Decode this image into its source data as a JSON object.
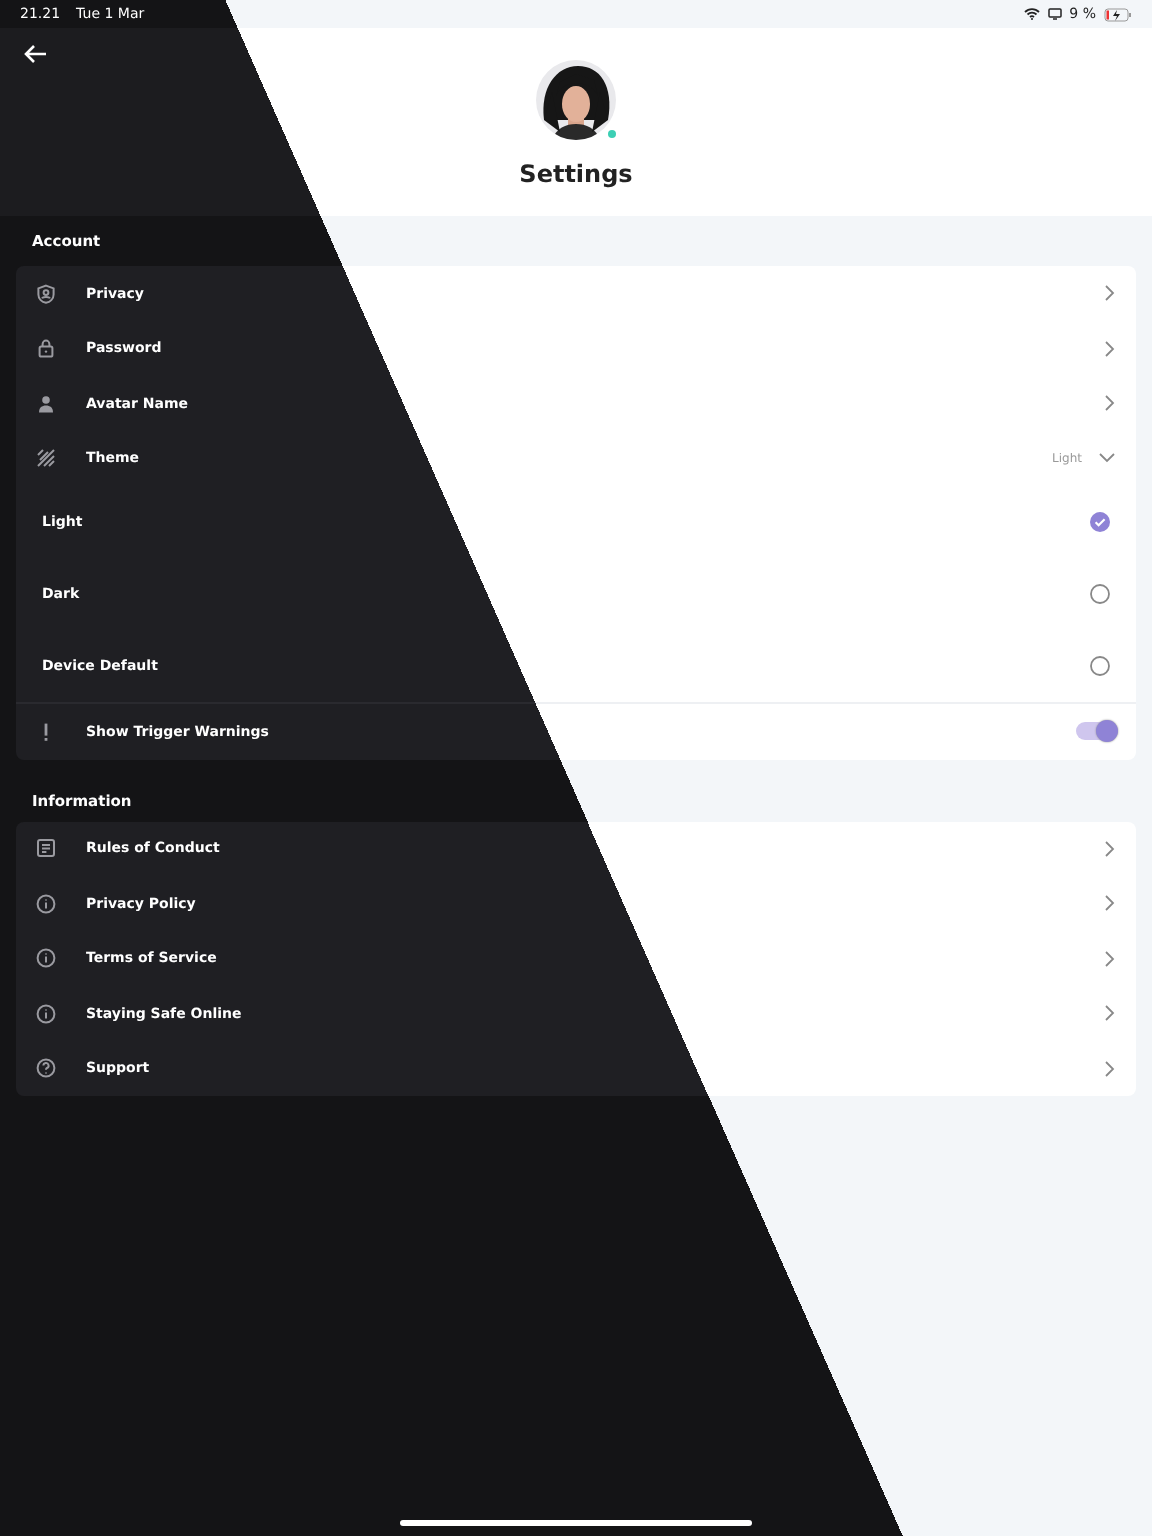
{
  "status_bar": {
    "time": "21.21",
    "date": "Tue 1 Mar",
    "battery": "9 %"
  },
  "header": {
    "title": "Settings",
    "avatar": {
      "kind": "picture",
      "online": true
    }
  },
  "sections": [
    {
      "title": "Account",
      "items": [
        {
          "kind": "link",
          "label": "Privacy"
        },
        {
          "kind": "link",
          "label": "Password"
        },
        {
          "kind": "link",
          "label": "Avatar Name"
        },
        {
          "kind": "select",
          "label": "Theme",
          "value": "Light",
          "expanded": true,
          "options": [
            {
              "label": "Light",
              "selected": true
            },
            {
              "label": "Dark",
              "selected": false
            },
            {
              "label": "Device Default",
              "selected": false
            }
          ]
        },
        {
          "kind": "toggle",
          "label": "Show Trigger Warnings",
          "on": true
        }
      ]
    },
    {
      "title": "Information",
      "items": [
        {
          "kind": "link",
          "label": "Rules of Conduct"
        },
        {
          "kind": "link",
          "label": "Privacy Policy"
        },
        {
          "kind": "link",
          "label": "Terms of Service"
        },
        {
          "kind": "link",
          "label": "Staying Safe Online"
        },
        {
          "kind": "link",
          "label": "Support"
        }
      ]
    }
  ]
}
